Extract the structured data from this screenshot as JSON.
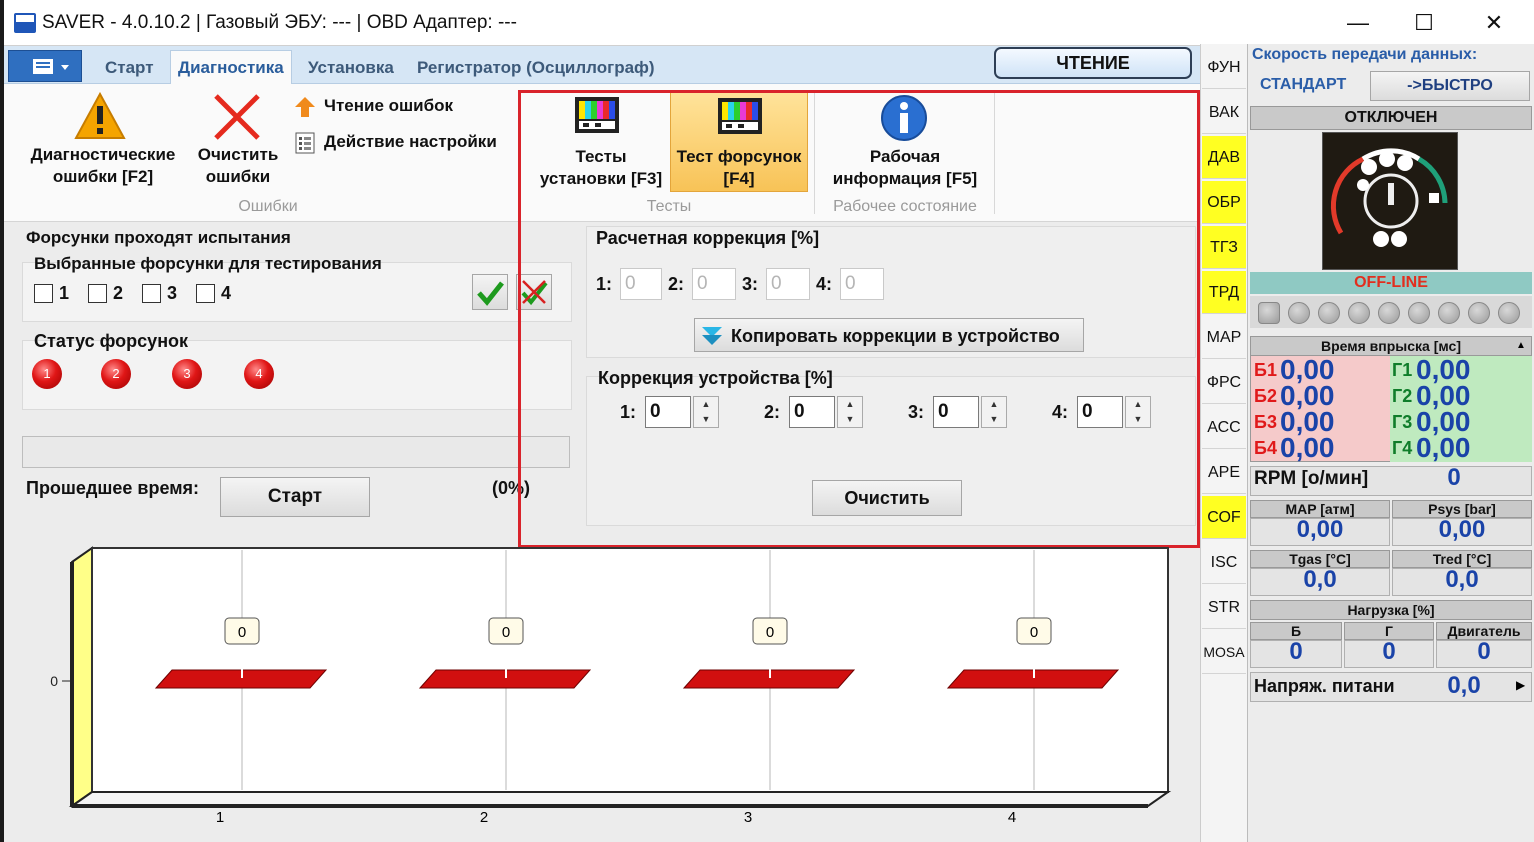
{
  "window": {
    "title": "SAVER - 4.0.10.2  |  Газовый ЭБУ: ---  |  OBD Адаптер: ---",
    "minimize": "—",
    "maximize": "☐",
    "close": "✕"
  },
  "menu": {
    "icon": "menu-icon"
  },
  "tabs": [
    "Старт",
    "Диагностика",
    "Установка",
    "Регистратор (Осциллограф)"
  ],
  "read_button": "ЧТЕНИЕ",
  "ribbon": {
    "diag_errors": {
      "line1": "Диагностические",
      "line2": "ошибки [F2]",
      "icon": "warning-icon"
    },
    "clear_errors": {
      "line1": "Очистить",
      "line2": "ошибки",
      "icon": "clear-x-icon"
    },
    "read_errors": "Чтение ошибок",
    "setup_action": "Действие настройки",
    "group_errors": "Ошибки",
    "install_tests": {
      "line1": "Тесты",
      "line2": "установки [F3]"
    },
    "injector_test": {
      "line1": "Тест форсунок",
      "line2": "[F4]"
    },
    "group_tests": "Тесты",
    "work_info": {
      "line1": "Рабочая",
      "line2": "информация [F5]",
      "icon": "info-icon"
    },
    "group_work": "Рабочее состояние"
  },
  "left": {
    "testing_title": "Форсунки проходят испытания",
    "selected_title": "Выбранные форсунки для тестирования",
    "checkboxes": [
      "1",
      "2",
      "3",
      "4"
    ],
    "status_title": "Статус форсунок",
    "leds": [
      "1",
      "2",
      "3",
      "4"
    ],
    "elapsed_label": "Прошедшее время:",
    "start_button": "Старт",
    "percent": "(0%)"
  },
  "correction": {
    "calc_title": "Расчетная коррекция [%]",
    "calc_labels": [
      "1:",
      "2:",
      "3:",
      "4:"
    ],
    "calc_values": [
      "0",
      "0",
      "0",
      "0"
    ],
    "copy_button": "Копировать коррекции в устройство",
    "device_title": "Коррекция устройства [%]",
    "device_labels": [
      "1:",
      "2:",
      "3:",
      "4:"
    ],
    "device_values": [
      "0",
      "0",
      "0",
      "0"
    ],
    "clear_button": "Очистить"
  },
  "chart_data": {
    "type": "bar",
    "categories": [
      "1",
      "2",
      "3",
      "4"
    ],
    "values": [
      0,
      0,
      0,
      0
    ],
    "data_labels": [
      "0",
      "0",
      "0",
      "0"
    ],
    "yticks": [
      "0"
    ],
    "colors": {
      "bar": "#d10f0f",
      "wall": "#ffff88"
    }
  },
  "side_tabs": [
    {
      "label": "ФУН",
      "yellow": false
    },
    {
      "label": "ВАК",
      "yellow": false
    },
    {
      "label": "ДАВ",
      "yellow": true
    },
    {
      "label": "ОБР",
      "yellow": true
    },
    {
      "label": "ТГЗ",
      "yellow": true
    },
    {
      "label": "ТРД",
      "yellow": true
    },
    {
      "label": "МАР",
      "yellow": false
    },
    {
      "label": "ФРС",
      "yellow": false
    },
    {
      "label": "АСС",
      "yellow": false
    },
    {
      "label": "АРЕ",
      "yellow": false
    },
    {
      "label": "СОF",
      "yellow": true
    },
    {
      "label": "ISC",
      "yellow": false
    },
    {
      "label": "STR",
      "yellow": false
    },
    {
      "label": "MOSA",
      "yellow": false
    }
  ],
  "right": {
    "speed_title": "Скорость передачи данных:",
    "speed_mode": "СТАНДАРТ",
    "fast_button": "->БЫСТРО",
    "conn_status": "ОТКЛЮЧЕН",
    "offline": "OFF-LINE",
    "inj_time_title": "Время впрыска [мс]",
    "inj_left": [
      {
        "label": "Б1",
        "value": "0,00"
      },
      {
        "label": "Б2",
        "value": "0,00"
      },
      {
        "label": "Б3",
        "value": "0,00"
      },
      {
        "label": "Б4",
        "value": "0,00"
      }
    ],
    "inj_right": [
      {
        "label": "Г1",
        "value": "0,00"
      },
      {
        "label": "Г2",
        "value": "0,00"
      },
      {
        "label": "Г3",
        "value": "0,00"
      },
      {
        "label": "Г4",
        "value": "0,00"
      }
    ],
    "rpm_label": "RPM [о/мин]",
    "rpm_value": "0",
    "map_label": "MAP [атм]",
    "map_value": "0,00",
    "psys_label": "Psys [bar]",
    "psys_value": "0,00",
    "tgas_label": "Tgas [°C]",
    "tgas_value": "0,0",
    "tred_label": "Tred [°C]",
    "tred_value": "0,0",
    "load_title": "Нагрузка [%]",
    "load_b_label": "Б",
    "load_b_value": "0",
    "load_g_label": "Г",
    "load_g_value": "0",
    "load_eng_label": "Двигатель",
    "load_eng_value": "0",
    "voltage_label": "Напряж. питани",
    "voltage_value": "0,0"
  }
}
